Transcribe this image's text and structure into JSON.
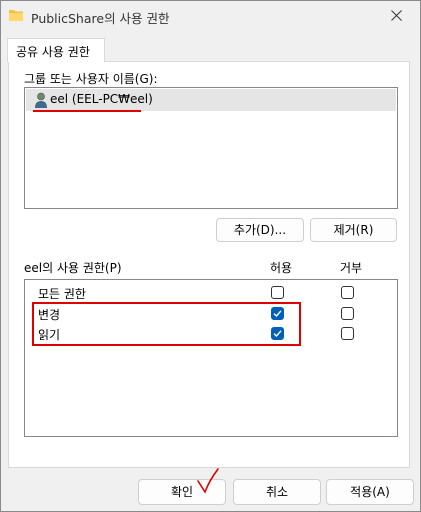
{
  "window": {
    "title": "PublicShare의 사용 권한",
    "tab_label": "공유 사용 권한"
  },
  "users_section": {
    "label": "그룹 또는 사용자 이름(G):",
    "users": [
      {
        "name": "eel (EEL-PC₩eel)",
        "icon": "user-icon"
      }
    ],
    "add_button": "추가(D)...",
    "remove_button": "제거(R)"
  },
  "permissions_section": {
    "label": "eel의 사용 권한(P)",
    "allow_header": "허용",
    "deny_header": "거부",
    "rows": [
      {
        "name": "모든 권한",
        "allow": false,
        "deny": false
      },
      {
        "name": "변경",
        "allow": true,
        "deny": false
      },
      {
        "name": "읽기",
        "allow": true,
        "deny": false
      }
    ]
  },
  "footer": {
    "ok": "확인",
    "cancel": "취소",
    "apply": "적용(A)"
  },
  "colors": {
    "annotation_red": "#e00000",
    "checkbox_blue": "#005fb8"
  }
}
